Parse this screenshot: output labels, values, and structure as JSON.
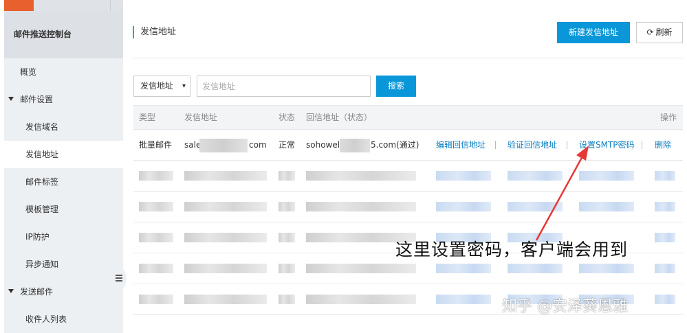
{
  "sidebar": {
    "title": "邮件推送控制台",
    "items": [
      {
        "label": "概览",
        "level": 1
      },
      {
        "label": "邮件设置",
        "level": 0,
        "expanded": true
      },
      {
        "label": "发信域名",
        "level": 2
      },
      {
        "label": "发信地址",
        "level": 2,
        "active": true
      },
      {
        "label": "邮件标签",
        "level": 2
      },
      {
        "label": "模板管理",
        "level": 2
      },
      {
        "label": "IP防护",
        "level": 2
      },
      {
        "label": "异步通知",
        "level": 2
      },
      {
        "label": "发送邮件",
        "level": 0,
        "expanded": true
      },
      {
        "label": "收件人列表",
        "level": 2
      }
    ]
  },
  "header": {
    "title": "发信地址",
    "new_button": "新建发信地址",
    "refresh_button": "刷新"
  },
  "filter": {
    "select_value": "发信地址",
    "search_placeholder": "发信地址",
    "search_button": "搜索"
  },
  "table": {
    "columns": {
      "type": "类型",
      "address": "发信地址",
      "status": "状态",
      "reply": "回信地址（状态）",
      "actions": "操作"
    },
    "first_row": {
      "type": "批量邮件",
      "address_prefix": "sale",
      "address_suffix": "com",
      "status": "正常",
      "reply_prefix": "sohowel",
      "reply_suffix": "5.com(通过)",
      "action_edit": "编辑回信地址",
      "action_verify": "验证回信地址",
      "action_smtp": "设置SMTP密码",
      "action_delete": "删除"
    }
  },
  "annotation": {
    "text": "这里设置密码，客户端会用到",
    "arrow_color": "#e53935"
  },
  "watermark": "知乎 @安泽葵恩雅",
  "colors": {
    "primary": "#0a97d9",
    "link": "#0a7ec2",
    "accent": "#e8602d"
  }
}
